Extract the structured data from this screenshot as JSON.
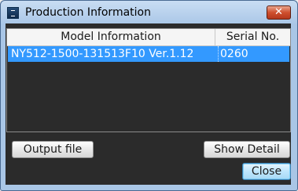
{
  "window": {
    "title": "Production Information",
    "close_glyph": "✕",
    "icon": "app-icon"
  },
  "table": {
    "columns": [
      "Model Information",
      "Serial No."
    ],
    "rows": [
      {
        "model": "NY512-1500-131513F10 Ver.1.12",
        "serial": "0260",
        "selected": true
      }
    ]
  },
  "buttons": {
    "output_file": "Output file",
    "show_detail": "Show Detail",
    "close": "Close"
  },
  "colors": {
    "selection": "#3399ff",
    "client_background": "#2b2b2b",
    "close_button": "#cf4f2e"
  }
}
